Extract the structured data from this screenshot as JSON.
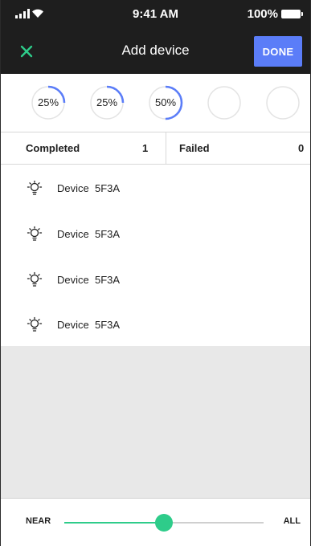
{
  "status_bar": {
    "time": "9:41 AM",
    "battery": "100%"
  },
  "header": {
    "title": "Add device",
    "done_label": "DONE"
  },
  "progress_rings": [
    {
      "label": "25%",
      "fraction": 0.25
    },
    {
      "label": "25%",
      "fraction": 0.25
    },
    {
      "label": "50%",
      "fraction": 0.5
    },
    {
      "label": "",
      "fraction": 0
    },
    {
      "label": "",
      "fraction": 0
    }
  ],
  "summary": {
    "completed_label": "Completed",
    "completed_count": "1",
    "failed_label": "Failed",
    "failed_count": "0"
  },
  "devices": [
    {
      "name": "Device  5F3A"
    },
    {
      "name": "Device  5F3A"
    },
    {
      "name": "Device  5F3A"
    },
    {
      "name": "Device  5F3A"
    }
  ],
  "range_slider": {
    "min_label": "NEAR",
    "max_label": "ALL",
    "value": 0.5
  },
  "colors": {
    "accent": "#5b7df8",
    "slider": "#2ecc8a",
    "close_icon": "#2ecc8a",
    "header_bg": "#1e1e1e",
    "empty_area": "#e8e8e8"
  }
}
